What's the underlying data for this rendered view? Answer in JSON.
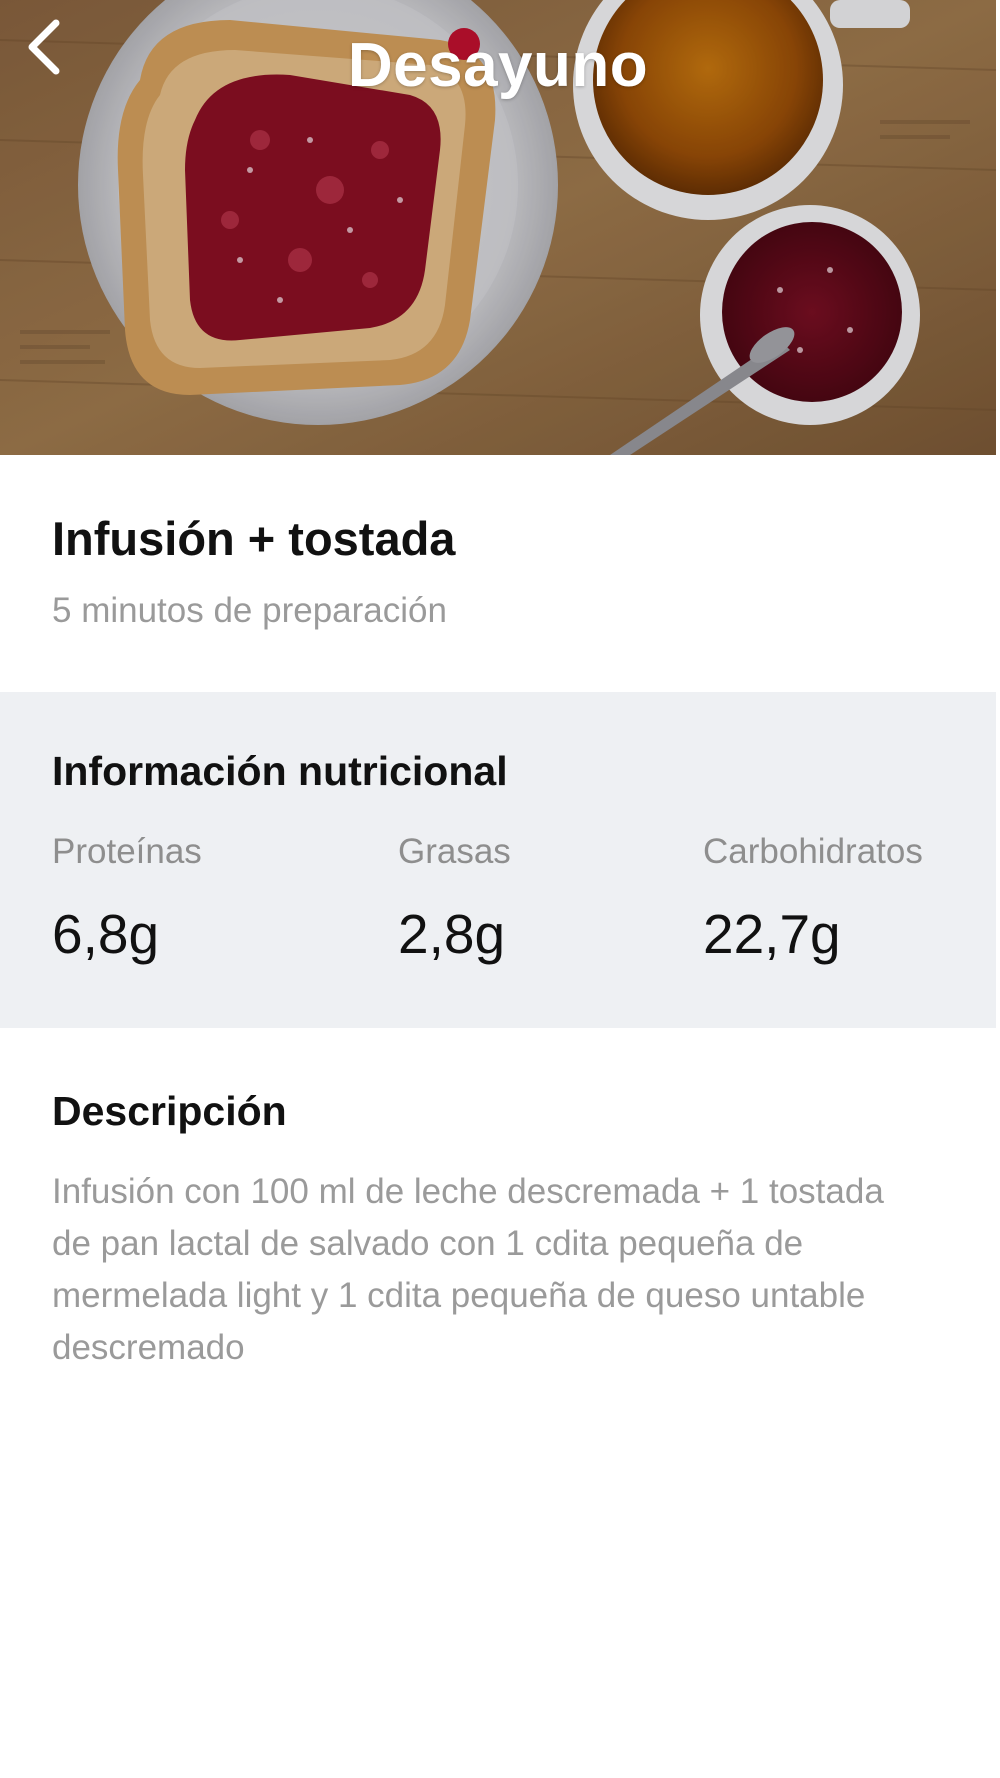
{
  "hero": {
    "title": "Desayuno",
    "back_icon": "chevron-left-icon",
    "image_subject": "toast with jam, tea cup and jam bowl"
  },
  "recipe": {
    "title": "Infusión + tostada",
    "prep_time": "5 minutos de preparación"
  },
  "nutrition": {
    "heading": "Información nutricional",
    "items": [
      {
        "label": "Proteínas",
        "value": "6,8g"
      },
      {
        "label": "Grasas",
        "value": "2,8g"
      },
      {
        "label": "Carbohidratos",
        "value": "22,7g"
      }
    ]
  },
  "description": {
    "heading": "Descripción",
    "text": "Infusión con 100 ml de leche descremada + 1 tostada de pan lactal de salvado con 1 cdita pequeña de mermelada light y 1 cdita pequeña de queso untable descremado"
  },
  "colors": {
    "nutrition_bg": "#eef0f3",
    "primary_text": "#111111",
    "secondary_text": "#9a9a9a"
  }
}
